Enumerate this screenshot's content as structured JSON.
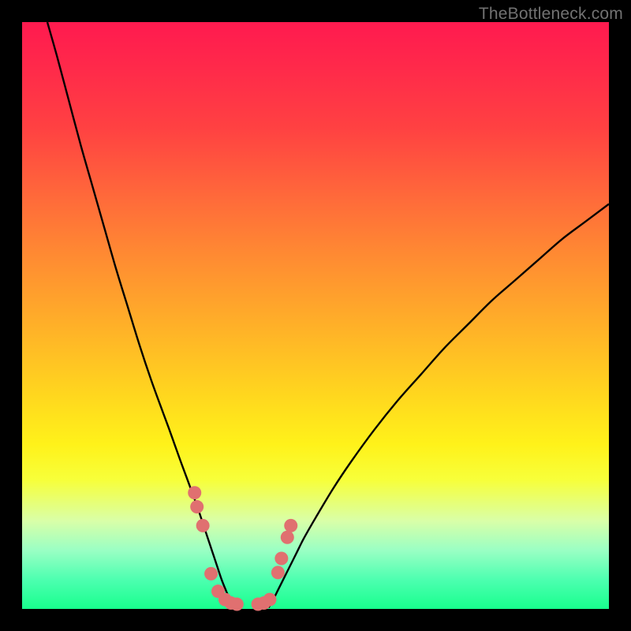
{
  "watermark": "TheBottleneck.com",
  "chart_data": {
    "type": "line",
    "title": "",
    "xlabel": "",
    "ylabel": "",
    "xlim": [
      0,
      100
    ],
    "ylim": [
      0,
      100
    ],
    "series": [
      {
        "name": "left-curve",
        "x": [
          4.3,
          6.0,
          8.0,
          10.0,
          12.0,
          14.0,
          16.0,
          18.0,
          20.0,
          22.0,
          24.0,
          25.0,
          26.0,
          27.0,
          28.0,
          29.0,
          30.0,
          30.8,
          31.6,
          32.4,
          33.2,
          34.0,
          34.8,
          35.6,
          36.2
        ],
        "y": [
          100.0,
          94.0,
          86.5,
          79.0,
          72.0,
          65.0,
          58.0,
          51.5,
          45.0,
          39.0,
          33.5,
          30.8,
          28.0,
          25.2,
          22.5,
          19.8,
          17.0,
          14.6,
          12.2,
          9.8,
          7.4,
          5.0,
          3.0,
          1.2,
          0.2
        ]
      },
      {
        "name": "right-curve",
        "x": [
          42.0,
          42.8,
          43.6,
          44.4,
          45.2,
          46.0,
          46.8,
          48.0,
          50.0,
          53.0,
          56.0,
          60.0,
          64.0,
          68.0,
          72.0,
          76.0,
          80.0,
          84.0,
          88.0,
          92.0,
          96.0,
          100.0
        ],
        "y": [
          0.2,
          1.6,
          3.2,
          4.8,
          6.4,
          8.0,
          9.6,
          12.0,
          15.5,
          20.5,
          25.0,
          30.5,
          35.5,
          40.0,
          44.5,
          48.5,
          52.5,
          56.0,
          59.5,
          63.0,
          66.0,
          69.0
        ]
      },
      {
        "name": "points-left",
        "x": [
          29.4,
          29.8,
          30.8,
          32.2,
          33.4,
          34.6,
          35.6,
          36.6
        ],
        "y": [
          19.8,
          17.4,
          14.2,
          6.0,
          3.0,
          1.6,
          1.0,
          0.8
        ]
      },
      {
        "name": "points-right",
        "x": [
          40.2,
          41.2,
          42.2,
          43.6,
          44.2,
          45.2,
          45.8
        ],
        "y": [
          0.8,
          1.0,
          1.6,
          6.2,
          8.6,
          12.2,
          14.2
        ]
      }
    ],
    "marker_color": "#e07070",
    "line_color": "#000000",
    "gradient_stops": [
      {
        "pos": 0,
        "color": "#ff1a4f"
      },
      {
        "pos": 50,
        "color": "#ffc81e"
      },
      {
        "pos": 78,
        "color": "#f7ff3a"
      },
      {
        "pos": 100,
        "color": "#18ff8e"
      }
    ]
  }
}
